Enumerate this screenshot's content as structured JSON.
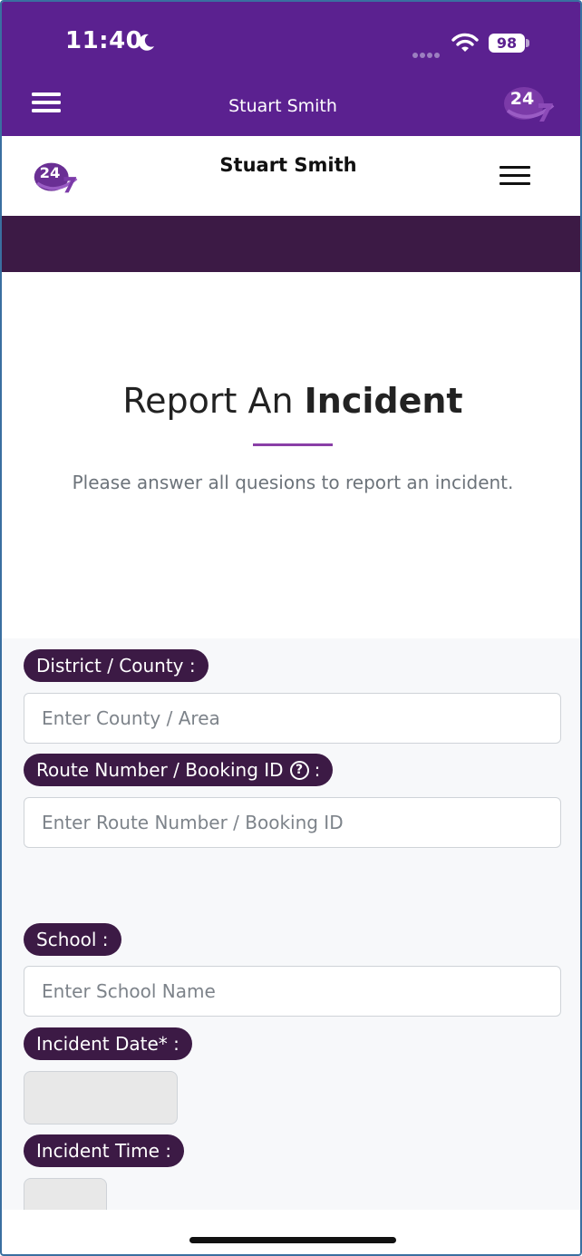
{
  "status_bar": {
    "time": "11:40",
    "battery": "98",
    "icons": [
      "moon-icon",
      "cellular-dots-icon",
      "wifi-icon",
      "battery-icon"
    ]
  },
  "app_bar": {
    "title": "Stuart Smith",
    "logo_text": "24",
    "icons": [
      "hamburger-menu-icon",
      "app-logo-icon"
    ]
  },
  "site_header": {
    "title": "Stuart Smith",
    "logo_text": "24",
    "icons": [
      "site-logo-icon",
      "hamburger-menu-icon"
    ]
  },
  "hero": {
    "title_plain": "Report An ",
    "title_bold": "Incident",
    "subtitle": "Please answer all quesions to report an incident."
  },
  "form": {
    "district": {
      "label": "District / County :",
      "placeholder": "Enter County / Area",
      "value": ""
    },
    "route": {
      "label": "Route Number / Booking ID",
      "label_suffix": ":",
      "help_icon": "?",
      "placeholder": "Enter Route Number / Booking ID",
      "value": ""
    },
    "school": {
      "label": "School :",
      "placeholder": "Enter School Name",
      "value": ""
    },
    "incident_date": {
      "label": "Incident Date* :",
      "value": ""
    },
    "incident_time": {
      "label": "Incident Time :",
      "value": ""
    }
  },
  "colors": {
    "app_bar": "#5b2190",
    "banner": "#3c1a45",
    "pill": "#3c1a45",
    "accent_rule": "#8a3fa7"
  }
}
